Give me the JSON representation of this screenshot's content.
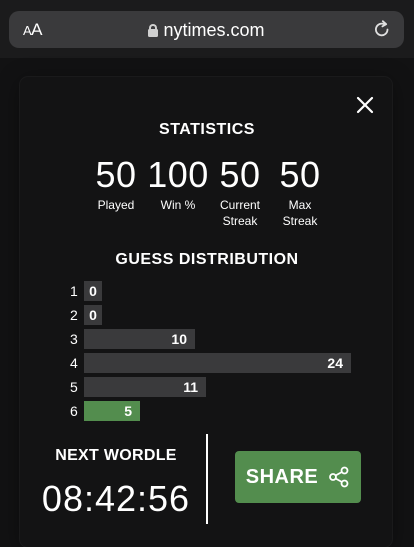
{
  "browser": {
    "aa_label_small": "A",
    "aa_label_large": "A",
    "url": "nytimes.com"
  },
  "modal": {
    "statistics_title": "STATISTICS",
    "stats": [
      {
        "value": "50",
        "label_line1": "Played",
        "label_line2": ""
      },
      {
        "value": "100",
        "label_line1": "Win %",
        "label_line2": ""
      },
      {
        "value": "50",
        "label_line1": "Current",
        "label_line2": "Streak"
      },
      {
        "value": "50",
        "label_line1": "Max",
        "label_line2": "Streak"
      }
    ],
    "distribution_title": "GUESS DISTRIBUTION",
    "distribution": [
      {
        "guess": "1",
        "count": 0
      },
      {
        "guess": "2",
        "count": 0
      },
      {
        "guess": "3",
        "count": 10
      },
      {
        "guess": "4",
        "count": 24
      },
      {
        "guess": "5",
        "count": 11
      },
      {
        "guess": "6",
        "count": 5
      }
    ],
    "highlight_guess": "6",
    "next_title": "NEXT WORDLE",
    "countdown": "08:42:56",
    "share_label": "SHARE"
  },
  "colors": {
    "background": "#121213",
    "bar": "#3a3a3c",
    "correct": "#538d4e"
  },
  "icons": {
    "lock": "lock-icon",
    "reload": "reload-icon",
    "close": "close-icon",
    "share": "share-icon"
  }
}
